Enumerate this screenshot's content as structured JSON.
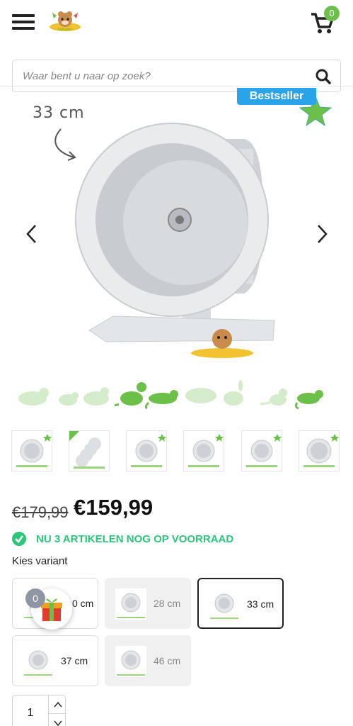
{
  "header": {
    "menu_icon": "hamburger-icon",
    "logo_icon": "hamster-logo-icon",
    "cart_icon": "cart-icon",
    "cart_count": "0"
  },
  "search": {
    "placeholder": "Waar bent u naar op zoek?",
    "button_icon": "search-icon"
  },
  "product": {
    "badge": "Bestseller",
    "size_note": "33 cm",
    "prev_icon": "chevron-left-icon",
    "next_icon": "chevron-right-icon",
    "accent_color": "#6cc04a",
    "thumbnail_count": 6
  },
  "pricing": {
    "old_price": "€179,99",
    "new_price": "€159,99"
  },
  "stock": {
    "text": "NU 3 ARTIKELEN NOG OP VOORRAAD",
    "color": "#2cc57a"
  },
  "variants": {
    "label": "Kies variant",
    "items": [
      {
        "label": "20 cm",
        "visible_label": "0 cm",
        "state": "available"
      },
      {
        "label": "28 cm",
        "state": "unavailable"
      },
      {
        "label": "33 cm",
        "state": "selected"
      },
      {
        "label": "37 cm",
        "state": "available"
      },
      {
        "label": "46 cm",
        "state": "unavailable"
      }
    ]
  },
  "gift": {
    "count": "0",
    "icon": "gift-icon"
  },
  "quantity": {
    "value": "1"
  }
}
